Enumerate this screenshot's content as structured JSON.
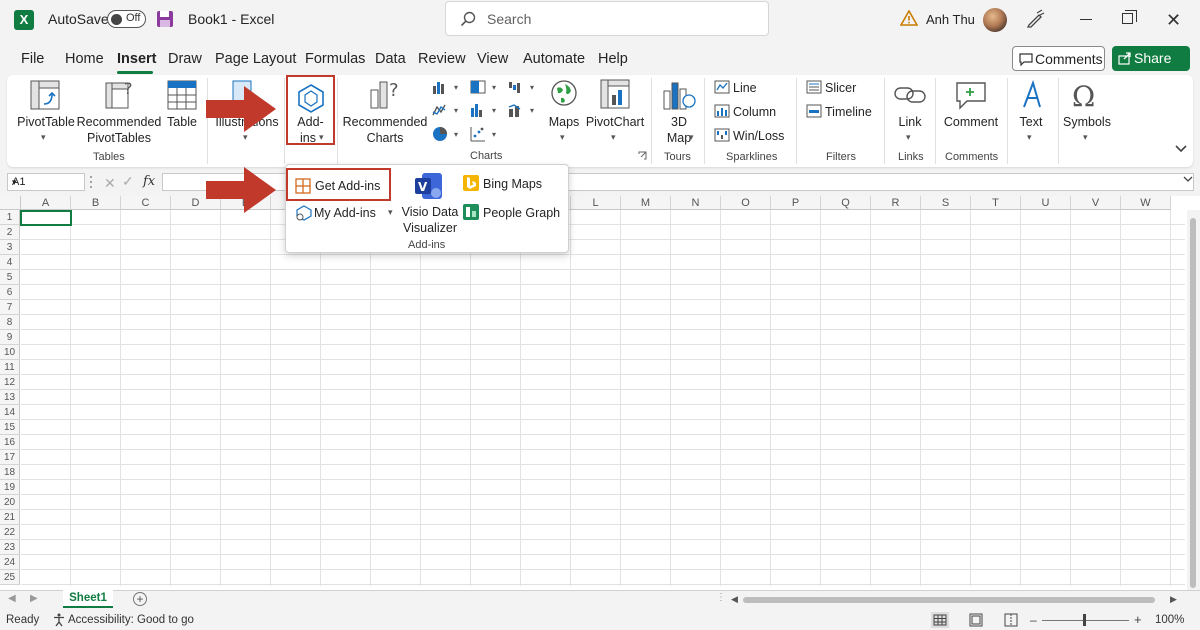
{
  "titlebar": {
    "app_logo": "X",
    "autosave_label": "AutoSave",
    "autosave_state": "Off",
    "doc_title": "Book1  -  Excel",
    "search_placeholder": "Search",
    "user_name": "Anh Thu"
  },
  "menu": {
    "tabs": [
      "File",
      "Home",
      "Insert",
      "Draw",
      "Page Layout",
      "Formulas",
      "Data",
      "Review",
      "View",
      "Automate",
      "Help"
    ],
    "active_tab": "Insert",
    "comments_label": "Comments",
    "share_label": "Share"
  },
  "ribbon": {
    "pivottable": "PivotTable",
    "recommended_pivottables": [
      "Recommended",
      "PivotTables"
    ],
    "table": "Table",
    "tables_group": "Tables",
    "illustrations": "Illustrations",
    "addins": [
      "Add-",
      "ins"
    ],
    "recommended_charts": [
      "Recommended",
      "Charts"
    ],
    "charts_group": "Charts",
    "maps": "Maps",
    "pivotchart": "PivotChart",
    "map3d": [
      "3D",
      "Map"
    ],
    "tours_group": "Tours",
    "sparkline_line": "Line",
    "sparkline_column": "Column",
    "sparkline_winloss": "Win/Loss",
    "sparklines_group": "Sparklines",
    "slicer": "Slicer",
    "timeline": "Timeline",
    "filters_group": "Filters",
    "link": "Link",
    "links_group": "Links",
    "comment": "Comment",
    "comments_group": "Comments",
    "text": "Text",
    "symbols": "Symbols"
  },
  "addins_dropdown": {
    "get_addins": "Get Add-ins",
    "my_addins": "My Add-ins",
    "visio": [
      "Visio Data",
      "Visualizer"
    ],
    "bing_maps": "Bing Maps",
    "people_graph": "People Graph",
    "group_label": "Add-ins"
  },
  "formula_bar": {
    "name_box": "A1",
    "fx": "fx"
  },
  "grid": {
    "columns": [
      "A",
      "B",
      "C",
      "D",
      "E",
      "F",
      "G",
      "H",
      "I",
      "J",
      "K",
      "L",
      "M",
      "N",
      "O",
      "P",
      "Q",
      "R",
      "S",
      "T",
      "U",
      "V",
      "W"
    ],
    "rows": [
      "1",
      "2",
      "3",
      "4",
      "5",
      "6",
      "7",
      "8",
      "9",
      "10",
      "11",
      "12",
      "13",
      "14",
      "15",
      "16",
      "17",
      "18",
      "19",
      "20",
      "21",
      "22",
      "23",
      "24",
      "25"
    ]
  },
  "sheets": {
    "tabs": [
      "Sheet1"
    ]
  },
  "status": {
    "ready": "Ready",
    "accessibility": "Accessibility: Good to go",
    "zoom": "100%"
  },
  "colors": {
    "excel_green": "#107c41",
    "annotation_red": "#c0392b"
  }
}
